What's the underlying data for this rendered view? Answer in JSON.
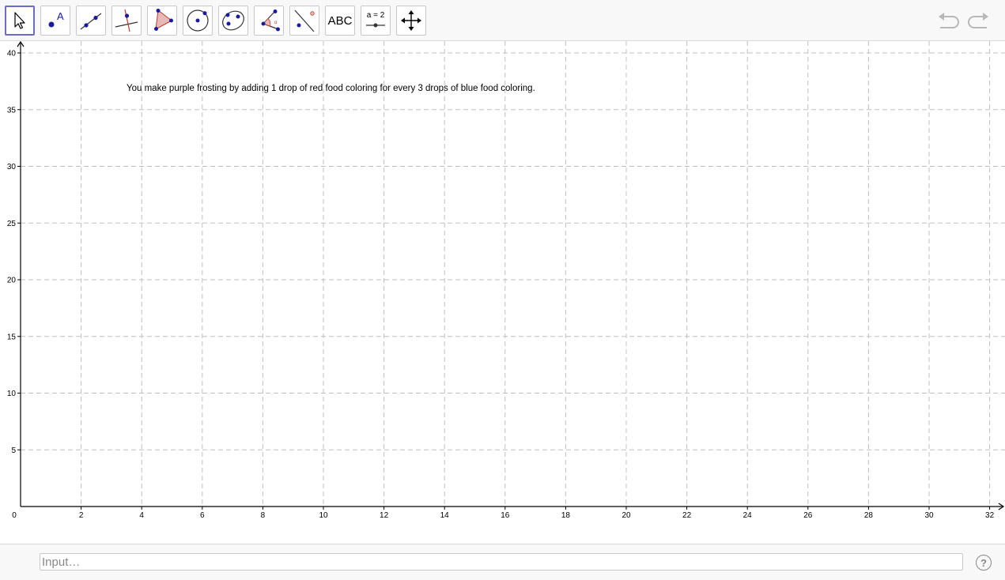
{
  "toolbar": {
    "tools": [
      {
        "id": "move",
        "icon": "cursor-arrow-icon",
        "selected": true
      },
      {
        "id": "point",
        "icon": "point-icon",
        "label": "A"
      },
      {
        "id": "line",
        "icon": "line-icon"
      },
      {
        "id": "perpendicular",
        "icon": "perpendicular-line-icon"
      },
      {
        "id": "polygon",
        "icon": "polygon-icon"
      },
      {
        "id": "circle",
        "icon": "circle-icon"
      },
      {
        "id": "ellipse",
        "icon": "ellipse-icon"
      },
      {
        "id": "angle",
        "icon": "angle-icon"
      },
      {
        "id": "reflect",
        "icon": "reflect-icon"
      },
      {
        "id": "text",
        "icon": "text-icon",
        "label": "ABC"
      },
      {
        "id": "slider",
        "icon": "slider-icon",
        "label": "a = 2"
      },
      {
        "id": "move-graphics",
        "icon": "move-graphics-icon"
      }
    ],
    "undo_icon": "undo-icon",
    "redo_icon": "redo-icon"
  },
  "graphics": {
    "text": "You make purple frosting by adding 1 drop of red food coloring for every 3 drops of blue food coloring.",
    "origin_label": "0",
    "x_ticks": [
      "2",
      "4",
      "6",
      "8",
      "10",
      "12",
      "14",
      "16",
      "18",
      "20",
      "22",
      "24",
      "26",
      "28",
      "30",
      "32"
    ],
    "y_ticks": [
      "5",
      "10",
      "15",
      "20",
      "25",
      "30",
      "35",
      "40"
    ],
    "grid_color": "#c0c0c0",
    "axis_color": "#000000"
  },
  "input": {
    "placeholder": "Input…",
    "help_label": "?"
  }
}
